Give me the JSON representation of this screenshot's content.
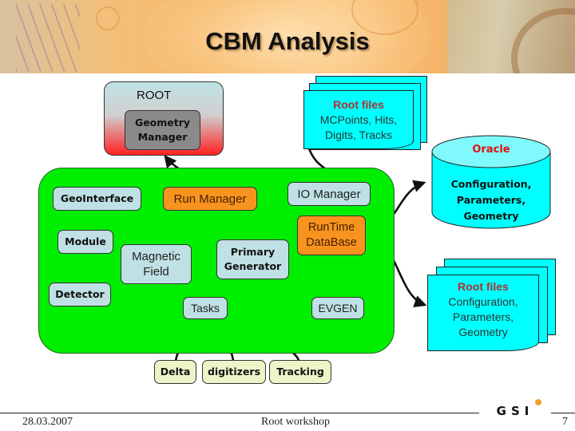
{
  "slide": {
    "title": "CBM Analysis",
    "footer": {
      "date": "28.03.2007",
      "event": "Root workshop",
      "page_number": "7",
      "logo": "GSI"
    }
  },
  "diagram": {
    "root_group": {
      "label": "ROOT",
      "geometry_manager": [
        "Geometry",
        "Manager"
      ]
    },
    "root_files_top": {
      "heading": "Root files",
      "lines": [
        "MCPoints,  Hits,",
        "Digits, Tracks"
      ]
    },
    "oracle": {
      "heading": "Oracle",
      "lines": [
        "Configuration,",
        "Parameters,",
        "Geometry"
      ]
    },
    "root_files_bottom": {
      "heading": "Root files",
      "lines": [
        "Configuration,",
        "Parameters,",
        "Geometry"
      ]
    },
    "framework": {
      "geointerface": "GeoInterface",
      "module": "Module",
      "detector": "Detector",
      "run_manager": "Run Manager",
      "io_manager": "IO Manager",
      "runtime_db": [
        "RunTime",
        "DataBase"
      ],
      "magnetic_field": [
        "Magnetic",
        "Field"
      ],
      "primary_generator": [
        "Primary",
        "Generator"
      ],
      "tasks": "Tasks",
      "evgen": "EVGEN"
    },
    "task_children": [
      "Delta",
      "digitizers",
      "Tracking"
    ],
    "colors": {
      "framework_bg": "#00ee00",
      "light_box": "#bfe0e4",
      "orange_box": "#f7931e",
      "file_cyan": "#00ffff",
      "heading_red": "#b03030",
      "oracle_red": "#e01010",
      "task_child": "#eef3c8"
    }
  }
}
